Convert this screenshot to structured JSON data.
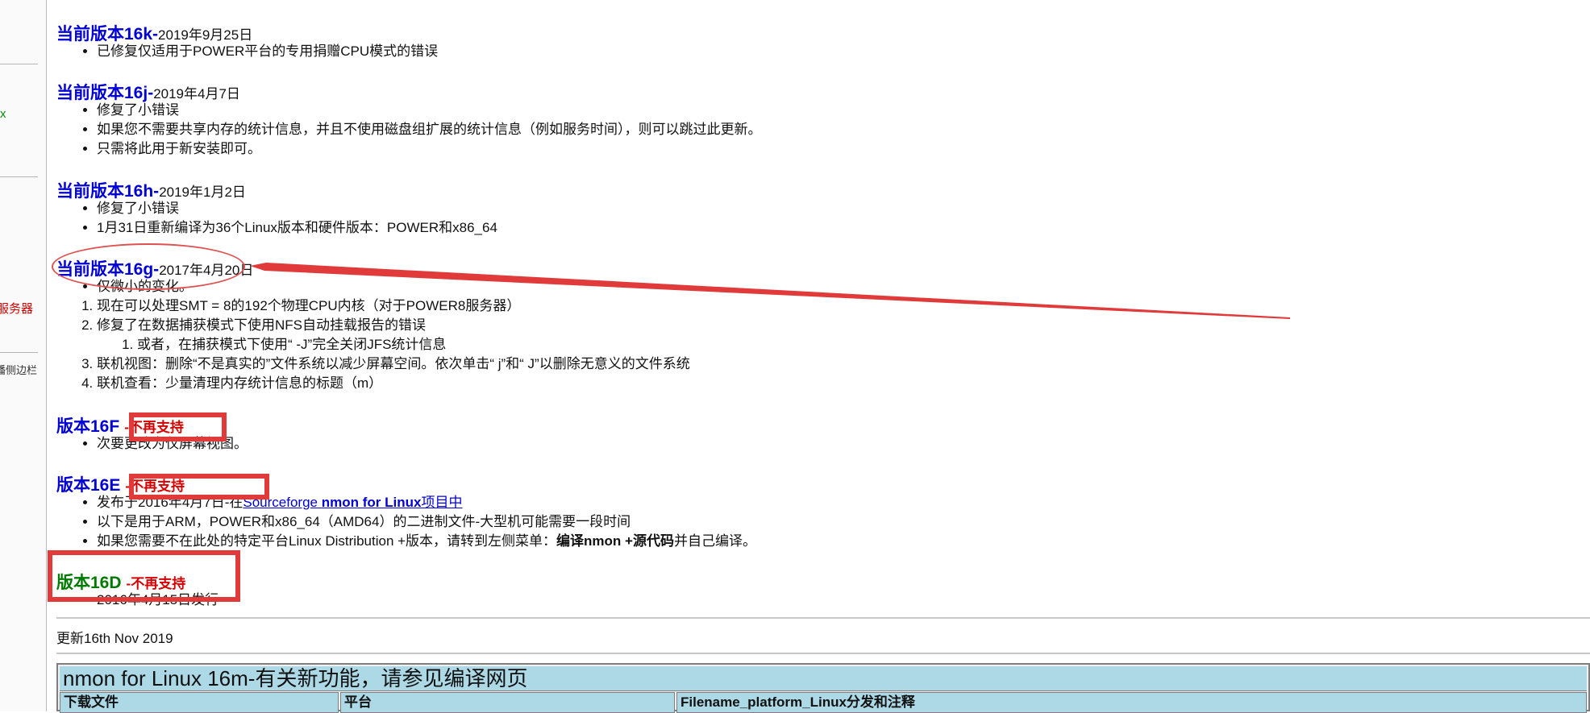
{
  "sidebar": {
    "item_x": "x",
    "item_server": "服务器",
    "item_collapse": "播侧边栏"
  },
  "versions": [
    {
      "title": "当前版本16k-",
      "date": "2019年9月25日",
      "items": [
        "已修复仅适用于POWER平台的专用捐赠CPU模式的错误"
      ]
    },
    {
      "title": "当前版本16j-",
      "date": "2019年4月7日",
      "items": [
        "修复了小错误",
        "如果您不需要共享内存的统计信息，并且不使用磁盘组扩展的统计信息（例如服务时间），则可以跳过此更新。",
        "只需将此用于新安装即可。"
      ]
    },
    {
      "title": "当前版本16h-",
      "date": "2019年1月2日",
      "items": [
        "修复了小错误",
        "1月31日重新编译为36个Linux版本和硬件版本：POWER和x86_64"
      ]
    },
    {
      "title": "当前版本16g-",
      "date": "2017年4月20日",
      "items": [
        "仅微小的变化。"
      ],
      "numbered": [
        "现在可以处理SMT = 8的192个物理CPU内核（对于POWER8服务器）",
        "修复了在数据捕获模式下使用NFS自动挂载报告的错误",
        "联机视图：删除“不是真实的”文件系统以减少屏幕空间。依次单击“ j”和“ J”以删除无意义的文件系统",
        "联机查看：少量清理内存统计信息的标题（m）"
      ],
      "sub": [
        "或者，在捕获模式下使用“ -J”完全关闭JFS统计信息"
      ]
    },
    {
      "title": "版本16F",
      "tag": "-不再支持",
      "items": [
        "次要更改为仅屏幕视图。"
      ]
    },
    {
      "title": "版本16E",
      "tag": "-不再支持",
      "items_prefix": "发布于2016年4月7日-在",
      "link": "Sourceforge",
      "link_bold": "nmon for Linux",
      "link_suffix": "项目中",
      "items": [
        "以下是用于ARM，POWER和x86_64（AMD64）的二进制文件-大型机可能需要一段时间"
      ],
      "compile_prefix": "如果您需要不在此处的特定平台Linux Distribution +版本，请转到左侧菜单：",
      "compile_bold": "编译nmon +源代码",
      "compile_suffix": "并自己编译。"
    },
    {
      "title": "版本16D",
      "tag": "-不再支持",
      "items": [
        "2016年4月15日发行"
      ]
    }
  ],
  "footer": {
    "updated": "更新16th Nov 2019"
  },
  "table": {
    "caption": "nmon for Linux 16m-有关新功能，请参见编译网页",
    "headers": [
      "下载文件",
      "平台",
      "Filename_platform_Linux分发和注释"
    ]
  },
  "annotations": {
    "box_color": "#e03a3a",
    "ellipse_color": "#e05050",
    "arrow_color": "#e03a3a"
  },
  "colors": {
    "version_blue": "#0000d6",
    "version_green": "#007a00",
    "unsupported_red": "#d40000",
    "table_header_bg": "#add8e6"
  }
}
